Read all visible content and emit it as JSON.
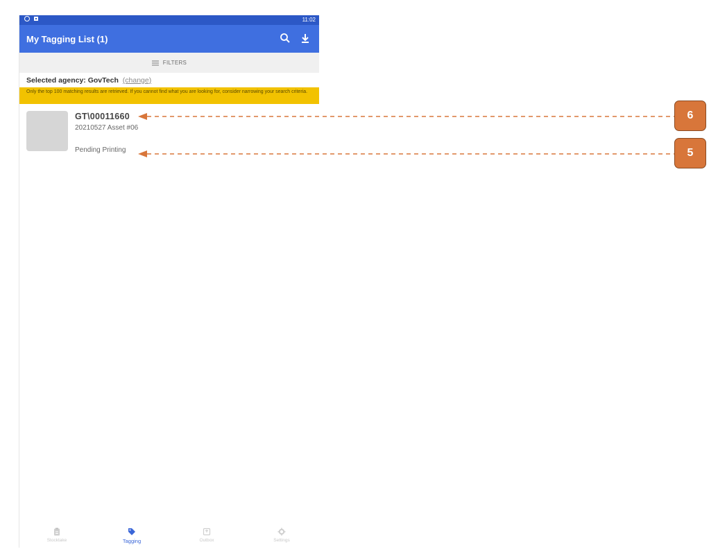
{
  "status_bar": {
    "time": "11:02"
  },
  "app_bar": {
    "title": "My Tagging List (1)",
    "search_icon": "search-icon",
    "download_icon": "download-icon"
  },
  "filters": {
    "label": "FILTERS",
    "icon": "filter-lines-icon"
  },
  "agency": {
    "label": "Selected agency:",
    "value": "GovTech",
    "change_link": "(change)"
  },
  "notice": {
    "text": "Only the top 100 matching results are retrieved. If you cannot find what you are looking for, consider narrowing your search criteria."
  },
  "items": [
    {
      "id": "GT\\00011660",
      "name": "20210527 Asset #06",
      "status": "Pending Printing"
    }
  ],
  "bottom_nav": [
    {
      "label": "Stocktake",
      "icon": "clipboard-icon",
      "active": false
    },
    {
      "label": "Tagging",
      "icon": "tag-icon",
      "active": true
    },
    {
      "label": "Outbox",
      "icon": "outbox-icon",
      "active": false
    },
    {
      "label": "Settings",
      "icon": "gear-icon",
      "active": false
    }
  ],
  "callouts": [
    {
      "number": "6"
    },
    {
      "number": "5"
    }
  ],
  "colors": {
    "app_bar": "#3f6fe0",
    "status_bar": "#2c58c6",
    "notice": "#f2c200",
    "callout": "#d8763a",
    "active_nav": "#3a66d8"
  }
}
